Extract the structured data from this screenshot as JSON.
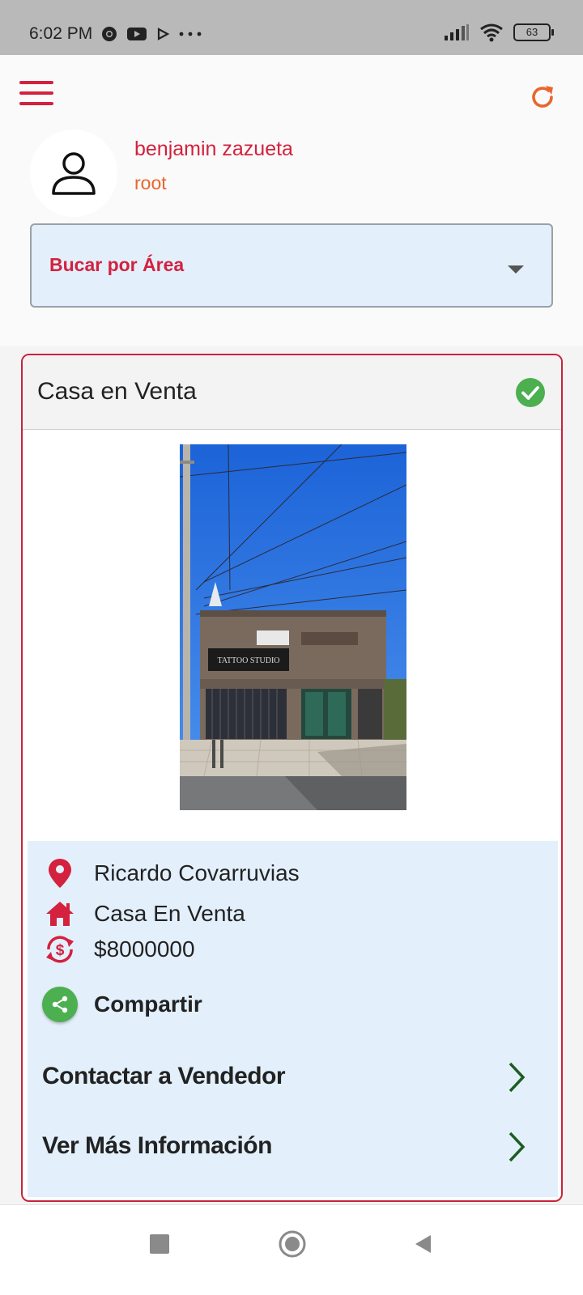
{
  "status_bar": {
    "time": "6:02 PM",
    "battery": "63",
    "icons": [
      "chrome-icon",
      "youtube-icon",
      "play-icon",
      "more-dots-icon",
      "signal-icon",
      "wifi-icon",
      "battery-icon"
    ]
  },
  "header": {
    "user_name": "benjamin zazueta",
    "user_role": "root",
    "area_select": {
      "label": "Bucar por Área"
    }
  },
  "colors": {
    "brand_red": "#d3213e",
    "accent_orange": "#e8662d",
    "info_bg": "#e3f0fc",
    "check_green": "#4caf50",
    "chevron_green": "#1b5e20"
  },
  "listing": {
    "title": "Casa en Venta",
    "verified_icon": "check-circle-icon",
    "owner": "Ricardo Covarruvias",
    "type": "Casa En Venta",
    "price": "$8000000",
    "share_label": "Compartir",
    "contact_label": "Contactar a Vendedor",
    "more_info_label": "Ver Más Información"
  },
  "nav_bar": {
    "buttons": [
      "recent-apps",
      "home",
      "back"
    ]
  }
}
